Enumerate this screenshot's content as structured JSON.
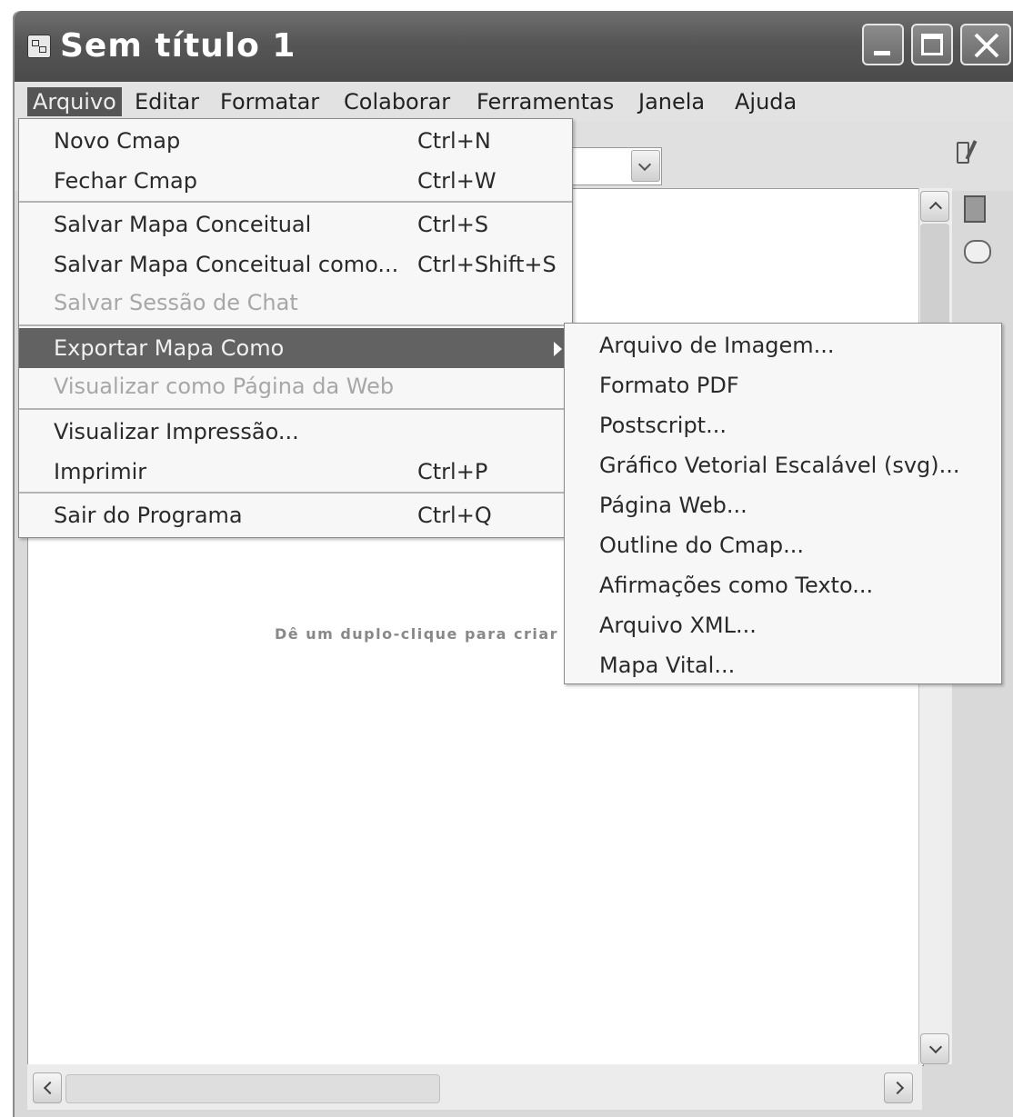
{
  "window": {
    "title": "Sem título 1"
  },
  "menubar": [
    "Arquivo",
    "Editar",
    "Formatar",
    "Colaborar",
    "Ferramentas",
    "Janela",
    "Ajuda"
  ],
  "file_menu": {
    "items": [
      {
        "label": "Novo Cmap",
        "shortcut": "Ctrl+N",
        "enabled": true
      },
      {
        "label": "Fechar Cmap",
        "shortcut": "Ctrl+W",
        "enabled": true
      },
      {
        "label": "Salvar Mapa Conceitual",
        "shortcut": "Ctrl+S",
        "enabled": true
      },
      {
        "label": "Salvar Mapa Conceitual como...",
        "shortcut": "Ctrl+Shift+S",
        "enabled": true
      },
      {
        "label": "Salvar Sessão de Chat",
        "shortcut": "",
        "enabled": false
      },
      {
        "label": "Exportar Mapa Como",
        "shortcut": "",
        "enabled": true,
        "highlighted": true,
        "submenu": true
      },
      {
        "label": "Visualizar como Página da Web",
        "shortcut": "",
        "enabled": false
      },
      {
        "label": "Visualizar Impressão...",
        "shortcut": "",
        "enabled": true
      },
      {
        "label": "Imprimir",
        "shortcut": "Ctrl+P",
        "enabled": true
      },
      {
        "label": "Sair do Programa",
        "shortcut": "Ctrl+Q",
        "enabled": true
      }
    ]
  },
  "export_submenu": [
    "Arquivo de Imagem...",
    "Formato PDF",
    "Postscript...",
    "Gráfico Vetorial Escalável (svg)...",
    "Página Web...",
    "Outline do Cmap...",
    "Afirmações como Texto...",
    "Arquivo XML...",
    "Mapa Vital..."
  ],
  "canvas": {
    "hint": "Dê um duplo-clique para criar u"
  },
  "colors": {
    "titlebar": "#565656",
    "menu_highlight": "#626262",
    "disabled_text": "#a7a7a7"
  }
}
